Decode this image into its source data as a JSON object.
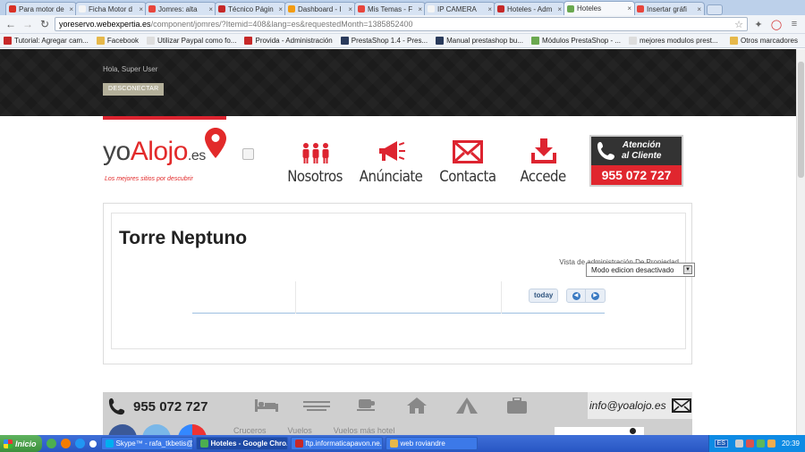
{
  "browser": {
    "tabs": [
      {
        "label": "Para motor de",
        "favicon_color": "#d93025",
        "active": false
      },
      {
        "label": "Ficha Motor d",
        "favicon_color": "#f4f4f4",
        "active": false
      },
      {
        "label": "Jomres: alta",
        "favicon_color": "#e8453c",
        "active": false
      },
      {
        "label": "Técnico Págin",
        "favicon_color": "#c62828",
        "active": false
      },
      {
        "label": "Dashboard - I",
        "favicon_color": "#f39c12",
        "active": false
      },
      {
        "label": "Mis Temas - F",
        "favicon_color": "#e8453c",
        "active": false
      },
      {
        "label": "IP CAMERA",
        "favicon_color": "#f4f4f4",
        "active": false
      },
      {
        "label": "Hoteles - Adm",
        "favicon_color": "#c62828",
        "active": false
      },
      {
        "label": "Hoteles",
        "favicon_color": "#6aa84f",
        "active": true
      },
      {
        "label": "Insertar gráfi",
        "favicon_color": "#e8453c",
        "active": false
      }
    ],
    "url_host": "yoreservo.webexpertia.es",
    "url_path": "/component/jomres/?Itemid=408&lang=es&requestedMonth=1385852400",
    "bookmarks": [
      {
        "label": "Tutorial: Agregar cam...",
        "color": "#c62828"
      },
      {
        "label": "Facebook",
        "color": "#e6b84a"
      },
      {
        "label": "Utilizar Paypal como fo...",
        "color": "#dddddd"
      },
      {
        "label": "Provida - Administración",
        "color": "#c62828"
      },
      {
        "label": "PrestaShop 1.4 - Pres...",
        "color": "#2a3b5c"
      },
      {
        "label": "Manual prestashop bu...",
        "color": "#2a3b5c"
      },
      {
        "label": "Módulos PrestaShop - ...",
        "color": "#6aa84f"
      },
      {
        "label": "mejores modulos prest...",
        "color": "#dddddd"
      }
    ],
    "other_bookmarks": "Otros marcadores"
  },
  "header": {
    "greeting": "Hola, Super User",
    "logout_label": "DESCONECTAR"
  },
  "logo": {
    "prefix": "yo",
    "brand": "Alojo",
    "tld": ".es",
    "tagline": "Los mejores sitios por descubrir"
  },
  "nav": [
    {
      "label": "Nosotros",
      "icon": "people-icon"
    },
    {
      "label": "Anúnciate",
      "icon": "megaphone-icon"
    },
    {
      "label": "Contacta",
      "icon": "envelope-icon"
    },
    {
      "label": "Accede",
      "icon": "download-icon"
    }
  ],
  "callbox": {
    "line1": "Atención",
    "line2": "al Cliente",
    "phone": "955 072 727"
  },
  "property": {
    "title": "Torre Neptuno",
    "admin_view": "Vista de administración De Propiedad",
    "edit_mode": "Modo edicion desactivado",
    "today_label": "today"
  },
  "footer": {
    "phone": "955 072 727",
    "email": "info@yoalojo.es",
    "links": [
      "Cruceros",
      "Vuelos",
      "Vuelos más hotel"
    ]
  },
  "taskbar": {
    "start_label": "Inicio",
    "windows": [
      {
        "label": "Skype™ - rafa_tkbetis@...",
        "color": "#00aff0",
        "active": false
      },
      {
        "label": "Hoteles - Google Chro...",
        "color": "#4caf50",
        "active": true
      },
      {
        "label": "ftp.informaticapavon.ne...",
        "color": "#c62828",
        "active": false
      },
      {
        "label": "web roviandre",
        "color": "#e6b84a",
        "active": false
      }
    ],
    "lang": "ES",
    "clock": "20:39"
  },
  "colors": {
    "accent_red": "#dd2430",
    "dark_band": "#1b1b1b"
  }
}
